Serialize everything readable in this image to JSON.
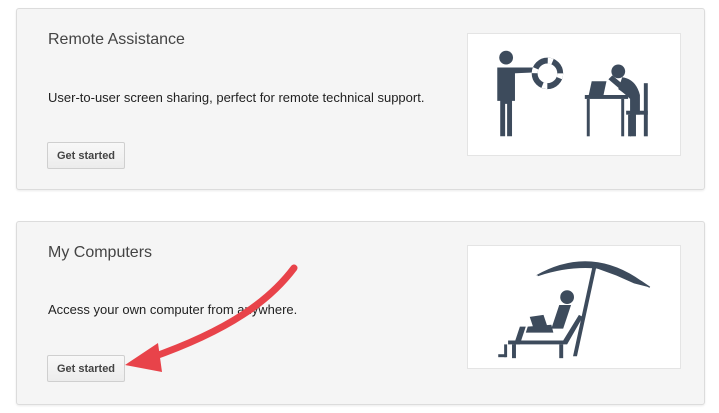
{
  "cards": [
    {
      "title": "Remote Assistance",
      "description": "User-to-user screen sharing, perfect for remote technical support.",
      "button_label": "Get started",
      "illustration": "person-offering-lifebuoy-to-stressed-person-at-computer"
    },
    {
      "title": "My Computers",
      "description": "Access your own computer from anywhere.",
      "button_label": "Get started",
      "illustration": "person-with-laptop-under-beach-umbrella"
    }
  ],
  "colors": {
    "card_background": "#f5f5f5",
    "illustration_ink": "#3d4b5c",
    "annotation_arrow": "#e8434a"
  }
}
